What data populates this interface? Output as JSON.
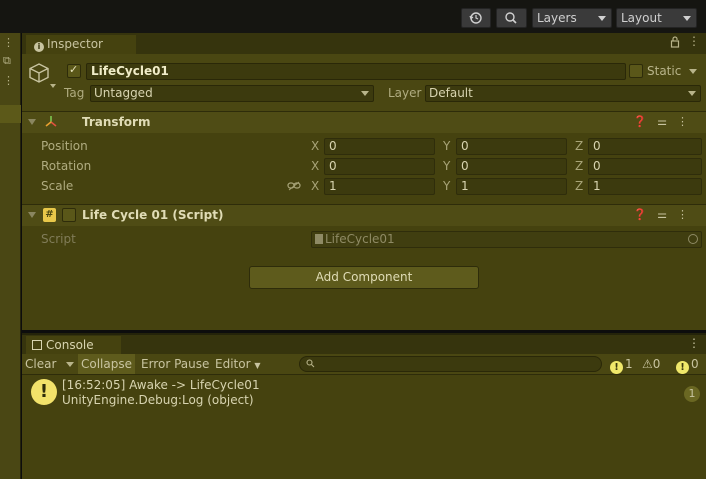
{
  "toolbar": {
    "history_icon": "history-icon",
    "search_icon": "search-icon",
    "layers_label": "Layers",
    "layout_label": "Layout"
  },
  "inspector": {
    "tab_label": "Inspector",
    "gameobject": {
      "active": true,
      "name": "LifeCycle01",
      "static_label": "Static",
      "static_checked": false,
      "tag_label": "Tag",
      "tag_value": "Untagged",
      "layer_label": "Layer",
      "layer_value": "Default"
    },
    "transform": {
      "title": "Transform",
      "rows": [
        {
          "label": "Position",
          "x": "0",
          "y": "0",
          "z": "0"
        },
        {
          "label": "Rotation",
          "x": "0",
          "y": "0",
          "z": "0"
        },
        {
          "label": "Scale",
          "x": "1",
          "y": "1",
          "z": "1"
        }
      ],
      "axis_x": "X",
      "axis_y": "Y",
      "axis_z": "Z"
    },
    "script_component": {
      "title": "Life Cycle 01 (Script)",
      "enabled": false,
      "script_label": "Script",
      "script_value": "LifeCycle01"
    },
    "add_component_label": "Add Component"
  },
  "console": {
    "tab_label": "Console",
    "toolbar": {
      "clear_label": "Clear",
      "collapse_label": "Collapse",
      "error_pause_label": "Error Pause",
      "editor_label": "Editor",
      "search_placeholder": "",
      "log_count": "1",
      "warning_count": "0",
      "error_count": "0"
    },
    "entries": [
      {
        "line1": "[16:52:05] Awake -> LifeCycle01",
        "line2": "UnityEngine.Debug:Log (object)",
        "count": "1"
      }
    ]
  },
  "colors": {
    "panel_bg": "#45420f",
    "toolbar_bg": "#151511",
    "warning_yellow": "#f2e26a"
  }
}
